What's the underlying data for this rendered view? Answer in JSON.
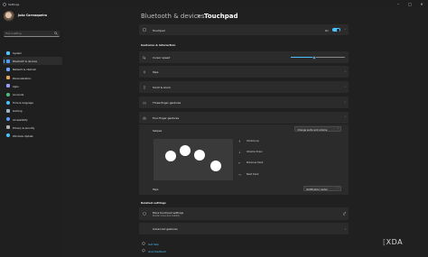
{
  "window": {
    "title": "Settings"
  },
  "user": {
    "name": "João Carrasqueira",
    "email": ""
  },
  "search": {
    "placeholder": "Find a setting"
  },
  "sidebar": {
    "items": [
      {
        "label": "System",
        "icon": "system-icon",
        "color": "#4cc2ff"
      },
      {
        "label": "Bluetooth & devices",
        "icon": "bluetooth-icon",
        "color": "#4c9fff",
        "active": true
      },
      {
        "label": "Network & internet",
        "icon": "network-icon",
        "color": "#6aa6ff"
      },
      {
        "label": "Personalization",
        "icon": "brush-icon",
        "color": "#e8a35a"
      },
      {
        "label": "Apps",
        "icon": "apps-icon",
        "color": "#9b9bff"
      },
      {
        "label": "Accounts",
        "icon": "accounts-icon",
        "color": "#47c27a"
      },
      {
        "label": "Time & language",
        "icon": "globe-icon",
        "color": "#4cc2ff"
      },
      {
        "label": "Gaming",
        "icon": "gaming-icon",
        "color": "#9ab4c8"
      },
      {
        "label": "Accessibility",
        "icon": "accessibility-icon",
        "color": "#5aa0ff"
      },
      {
        "label": "Privacy & security",
        "icon": "shield-icon",
        "color": "#b0b0b0"
      },
      {
        "label": "Windows Update",
        "icon": "update-icon",
        "color": "#4cc2ff"
      }
    ]
  },
  "breadcrumb": {
    "parent": "Bluetooth & devices",
    "separator": ">",
    "current": "Touchpad"
  },
  "touchpad": {
    "label": "Touchpad",
    "state": "On"
  },
  "gestures_section": {
    "title": "Gestures & interaction"
  },
  "cursor_speed": {
    "label": "Cursor speed",
    "value_fraction": 0.43
  },
  "rows": {
    "taps": "Taps",
    "scroll_zoom": "Scroll & zoom",
    "three_finger": "Three-finger gestures",
    "four_finger": "Four-finger gestures"
  },
  "swipes": {
    "label": "Swipes",
    "value": "Change audio and volume"
  },
  "legend": [
    {
      "arrow": "↑",
      "label": "Volume up"
    },
    {
      "arrow": "↓",
      "label": "Volume down"
    },
    {
      "arrow": "←",
      "label": "Previous track"
    },
    {
      "arrow": "→",
      "label": "Next track"
    }
  ],
  "taps_setting": {
    "label": "Taps",
    "value": "Notification center"
  },
  "related": {
    "title": "Related settings",
    "more": {
      "label": "More touchpad settings",
      "sub": "Pointer icons and visibility"
    },
    "advanced": {
      "label": "Advanced gestures"
    }
  },
  "links": {
    "help": "Get help",
    "feedback": "Give feedback"
  },
  "watermark": "XDA",
  "accent": "#4cc2ff"
}
